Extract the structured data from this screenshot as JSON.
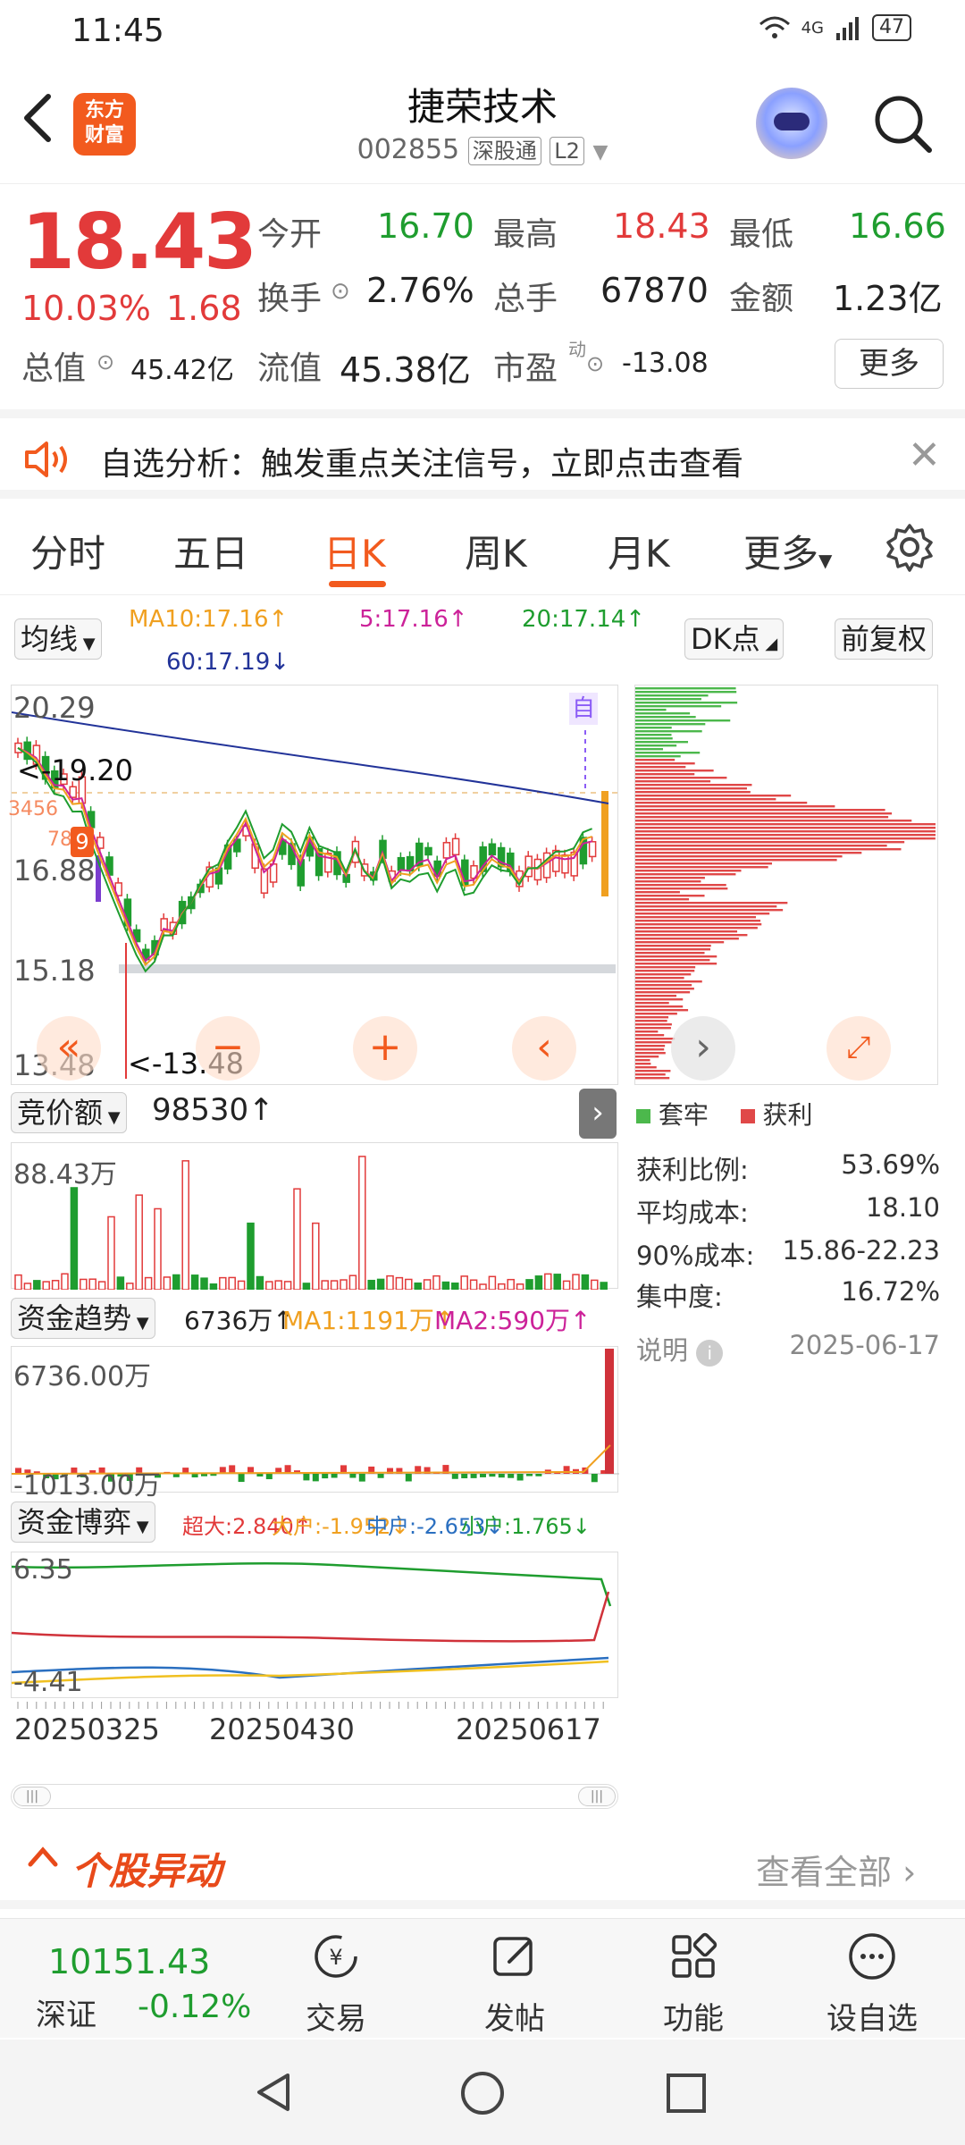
{
  "status": {
    "time": "11:45",
    "network": "4G",
    "battery": "47"
  },
  "header": {
    "logo_line1": "东方",
    "logo_line2": "财富",
    "title": "捷荣技术",
    "code": "002855",
    "tag_connect": "深股通",
    "tag_level": "L2"
  },
  "quote": {
    "price": "18.43",
    "change_pct": "10.03%",
    "change": "1.68",
    "open_label": "今开",
    "open": "16.70",
    "high_label": "最高",
    "high": "18.43",
    "low_label": "最低",
    "low": "16.66",
    "turnover_label": "换手",
    "turnover": "2.76%",
    "volume_label": "总手",
    "volume": "67870",
    "amount_label": "金额",
    "amount": "1.23亿",
    "mktcap_label": "总值",
    "mktcap": "45.42亿",
    "float_label": "流值",
    "float_cap": "45.38亿",
    "pe_label": "市盈",
    "pe_sup": "动",
    "pe": "-13.08",
    "more_label": "更多"
  },
  "notice": {
    "text": "自选分析：触发重点关注信号，立即点击查看"
  },
  "tabs": [
    "分时",
    "五日",
    "日K",
    "周K",
    "月K",
    "更多"
  ],
  "chart_controls": {
    "ma_select": "均线",
    "ma10": "MA10:17.16↑",
    "ma5": "5:17.16↑",
    "ma20": "20:17.14↑",
    "ma60": "60:17.19↓",
    "dk_select": "DK点",
    "adjust": "前复权"
  },
  "main_chart": {
    "y_top": "20.29",
    "y_mid": "16.88",
    "y_low": "15.18",
    "y_bottom": "13.48",
    "max_marker": "<-19.20",
    "min_marker": "<-13.48",
    "self_tag": "自",
    "left_tags": [
      "3456",
      "78",
      "9"
    ]
  },
  "auction": {
    "select": "竞价额",
    "value": "98530↑",
    "y_top": "88.43万"
  },
  "capital_trend": {
    "select": "资金趋势",
    "value": "6736万↑",
    "ma1": "MA1:1191万↑",
    "ma2": "MA2:590万↑",
    "y_top": "6736.00万",
    "y_bottom": "-1013.00万"
  },
  "capital_game": {
    "select": "资金博弈",
    "large": "超大:2.840↑",
    "big": "大户:-1.952↓",
    "mid": "中户:-2.653↓",
    "small": "小户:1.765↓",
    "y_top": "6.35",
    "y_bottom": "-4.41"
  },
  "dates": [
    "20250325",
    "20250430",
    "20250617"
  ],
  "distribution": {
    "legend_trapped": "套牢",
    "legend_profit": "获利",
    "stats": [
      {
        "label": "获利比例:",
        "value": "53.69%"
      },
      {
        "label": "平均成本:",
        "value": "18.10"
      },
      {
        "label": "90%成本:",
        "value": "15.86-22.23"
      },
      {
        "label": "集中度:",
        "value": "16.72%"
      }
    ],
    "note_label": "说明",
    "date": "2025-06-17"
  },
  "anomaly": {
    "title": "个股异动",
    "view_all": "查看全部"
  },
  "bottom_bar": {
    "index_value": "10151.43",
    "index_name": "深证",
    "index_change": "-0.12%",
    "items": [
      "交易",
      "发帖",
      "功能",
      "设自选"
    ]
  },
  "colors": {
    "accent": "#f25a1e",
    "up": "#e23a3a",
    "down": "#1f9d2f"
  }
}
